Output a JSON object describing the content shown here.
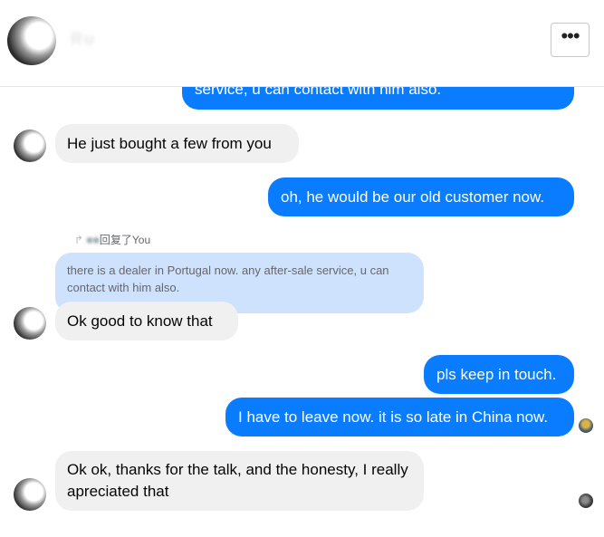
{
  "header": {
    "contact_name": "Ru",
    "more_button_label": "•••"
  },
  "messages": [
    {
      "from": "me",
      "text": "service, u can contact with him also."
    },
    {
      "from": "them",
      "text": "He just bought a few from you"
    },
    {
      "from": "me",
      "text": "oh, he would be our old customer now."
    },
    {
      "from": "them",
      "reply_label": "回复了You",
      "quote": "there is a dealer in Portugal now. any after-sale service, u can contact with him also.",
      "text": "Ok good to know that"
    },
    {
      "from": "me",
      "text": "pls keep in touch."
    },
    {
      "from": "me",
      "text": "I have to leave now. it is so late in China now."
    },
    {
      "from": "them",
      "text": "Ok ok, thanks for the talk, and the honesty, I really apreciated that"
    }
  ]
}
